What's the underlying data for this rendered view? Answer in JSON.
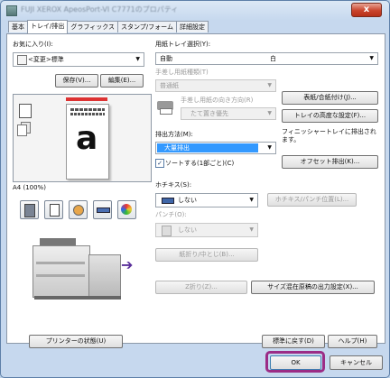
{
  "window": {
    "title": "FUJI XEROX ApeosPort-VI C7771のプロパティ",
    "close_label": "x"
  },
  "tabs": [
    "基本",
    "トレイ/排出",
    "グラフィックス",
    "スタンプ/フォーム",
    "詳細設定"
  ],
  "favorites": {
    "label": "お気に入り(I):",
    "value": "<変更>標準",
    "save_label": "保存(V)...",
    "edit_label": "編集(E)..."
  },
  "preview": {
    "paper_letter": "a",
    "size_label": "A4 (100%)"
  },
  "paper_tray": {
    "label": "用紙トレイ選択(Y):",
    "tray_value": "自動",
    "color_value": "白",
    "manual_label": "手差し用紙種類(T)",
    "manual_value": "普通紙",
    "orientation_label": "手差し用紙の向き方向(R)",
    "orientation_value": "たて置き優先",
    "cover_button": "表紙/合紙付け(J)...",
    "tray_advanced_button": "トレイの高度な設定(F)..."
  },
  "output": {
    "label": "排出方法(M):",
    "value": "大量排出",
    "sort_label": "ソートする(1部ごと)(C)",
    "sort_checked": true,
    "finisher_note": "フィニッシャートレイに排出されます。",
    "offset_button": "オフセット排出(K)..."
  },
  "staple": {
    "label": "ホチキス(S):",
    "value": "しない",
    "position_button": "ホチキス/パンチ位置(L)...",
    "punch_label": "パンチ(O):",
    "punch_value": "しない",
    "fold_button": "紙折り/中とじ(B)..."
  },
  "zfold_button": "Z折り(Z)...",
  "mixed_size_button": "サイズ混在原稿の出力設定(X)...",
  "printer_status_button": "プリンターの状態(U)",
  "restore_button": "標準に戻す(D)",
  "help_button": "ヘルプ(H)",
  "ok_button": "OK",
  "cancel_button": "キャンセル",
  "colors": {
    "highlight": "#9b2c86",
    "selection": "#3399ff"
  }
}
